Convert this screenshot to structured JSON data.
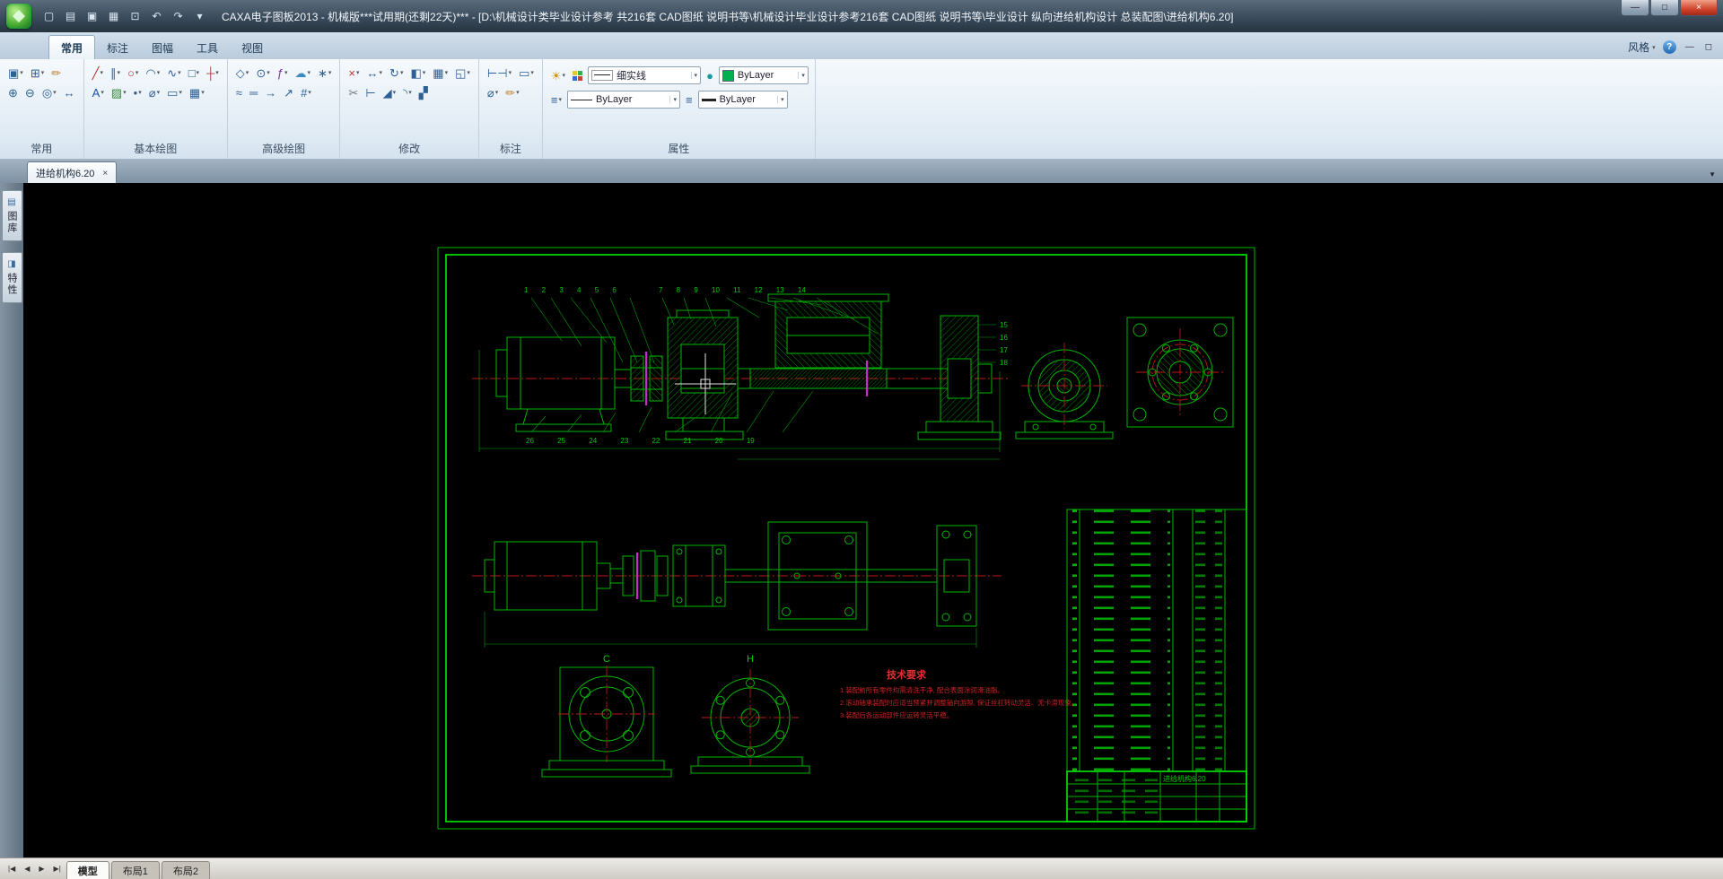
{
  "title_bar": {
    "title": "CAXA电子图板2013 - 机械版***试用期(还剩22天)*** - [D:\\机械设计类毕业设计参考 共216套 CAD图纸 说明书等\\机械设计毕业设计参考216套 CAD图纸 说明书等\\毕业设计 纵向进给机构设计 总装配图\\进给机构6.20]",
    "quick_icons": [
      {
        "n": "new",
        "g": "▢"
      },
      {
        "n": "open",
        "g": "▤"
      },
      {
        "n": "save",
        "g": "▣"
      },
      {
        "n": "print",
        "g": "▦"
      },
      {
        "n": "print-preview",
        "g": "⊡"
      },
      {
        "n": "undo",
        "g": "↶"
      },
      {
        "n": "redo",
        "g": "↷"
      },
      {
        "n": "customize-toolbar",
        "g": "▾"
      }
    ],
    "window_buttons": {
      "minimize": "—",
      "maximize": "□",
      "close": "×"
    }
  },
  "glyphs": {
    "dropdown": "▾",
    "help": "?",
    "ribbon_minimize": "—",
    "ribbon_expand": "◻",
    "doc_tab_scroll": "▼",
    "close_tab": "×"
  },
  "ribbon": {
    "style_label": "风格",
    "tabs": [
      {
        "label": "常用",
        "active": true
      },
      {
        "label": "标注",
        "active": false
      },
      {
        "label": "图幅",
        "active": false
      },
      {
        "label": "工具",
        "active": false
      },
      {
        "label": "视图",
        "active": false
      }
    ],
    "groups": [
      {
        "label": "常用",
        "rows": [
          [
            {
              "n": "paste",
              "g": "▣",
              "a": true
            },
            {
              "n": "copy",
              "g": "⊞",
              "a": true
            },
            {
              "n": "format-brush",
              "g": "✏",
              "a": false,
              "c": "#c08030"
            }
          ],
          [
            {
              "n": "zoom-in",
              "g": "⊕",
              "a": false
            },
            {
              "n": "zoom-out",
              "g": "⊖",
              "a": false
            },
            {
              "n": "zoom-all",
              "g": "◎",
              "a": true
            },
            {
              "n": "pan",
              "g": "↔",
              "a": false
            }
          ]
        ]
      },
      {
        "label": "基本绘图",
        "rows": [
          [
            {
              "n": "line",
              "g": "╱",
              "a": true,
              "c": "#b03030"
            },
            {
              "n": "parallel-line",
              "g": "∥",
              "a": true
            },
            {
              "n": "circle",
              "g": "○",
              "a": true,
              "c": "#b03030"
            },
            {
              "n": "arc",
              "g": "◠",
              "a": true
            },
            {
              "n": "spline",
              "g": "∿",
              "a": true
            },
            {
              "n": "rectangle",
              "g": "□",
              "a": true
            },
            {
              "n": "center-line",
              "g": "┼",
              "a": true,
              "c": "#a04040"
            }
          ],
          [
            {
              "n": "text",
              "g": "A",
              "a": true,
              "c": "#1f4fa0"
            },
            {
              "n": "hatch",
              "g": "▨",
              "a": true,
              "c": "#3a8a3a"
            },
            {
              "n": "point",
              "g": "•",
              "a": true
            },
            {
              "n": "hole-axis",
              "g": "⌀",
              "a": true
            },
            {
              "n": "block",
              "g": "▭",
              "a": true
            },
            {
              "n": "table",
              "g": "▦",
              "a": true
            }
          ]
        ]
      },
      {
        "label": "高级绘图",
        "rows": [
          [
            {
              "n": "polygon",
              "g": "◇",
              "a": true
            },
            {
              "n": "ellipse",
              "g": "⊙",
              "a": true
            },
            {
              "n": "formula-curve",
              "g": "ƒ",
              "a": true,
              "c": "#8030a0"
            },
            {
              "n": "revision-cloud",
              "g": "☁",
              "a": true,
              "c": "#3a8ac0"
            },
            {
              "n": "gear",
              "g": "∗",
              "a": true
            }
          ],
          [
            {
              "n": "wave-line",
              "g": "≈",
              "a": false
            },
            {
              "n": "double-line",
              "g": "═",
              "a": false
            },
            {
              "n": "arrow-line",
              "g": "→",
              "a": false
            },
            {
              "n": "leader-curve",
              "g": "↗",
              "a": false
            },
            {
              "n": "symbol",
              "g": "#",
              "a": true
            }
          ]
        ]
      },
      {
        "label": "修改",
        "rows": [
          [
            {
              "n": "erase",
              "g": "×",
              "a": true,
              "c": "#c03030"
            },
            {
              "n": "move",
              "g": "↔",
              "a": true
            },
            {
              "n": "rotate",
              "g": "↻",
              "a": true
            },
            {
              "n": "mirror",
              "g": "◧",
              "a": true
            },
            {
              "n": "array",
              "g": "▦",
              "a": true
            },
            {
              "n": "scale",
              "g": "◱",
              "a": true
            }
          ],
          [
            {
              "n": "trim",
              "g": "✂",
              "a": false,
              "c": "#707880"
            },
            {
              "n": "extend",
              "g": "⊢",
              "a": false
            },
            {
              "n": "chamfer",
              "g": "◢",
              "a": true
            },
            {
              "n": "fillet",
              "g": "◝",
              "a": true
            },
            {
              "n": "explode",
              "g": "▞",
              "a": false
            }
          ]
        ]
      },
      {
        "label": "标注",
        "rows": [
          [
            {
              "n": "dimension",
              "g": "⊢⊣",
              "a": true,
              "c": "#2060a0"
            },
            {
              "n": "dim-style",
              "g": "▭",
              "a": true
            }
          ],
          [
            {
              "n": "diameter-dim",
              "g": "⌀",
              "a": true
            },
            {
              "n": "dim-edit",
              "g": "✏",
              "a": true,
              "c": "#c08030"
            }
          ]
        ]
      }
    ],
    "properties": {
      "label": "属性",
      "linetype": "细实线",
      "color": "ByLayer",
      "linestyle": "ByLayer",
      "lineweight": "ByLayer"
    }
  },
  "doc_tabs": [
    {
      "label": "进给机构6.20",
      "active": true
    }
  ],
  "side_tabs": [
    {
      "label": "图库",
      "icon": "▤"
    },
    {
      "label": "特性",
      "icon": "◨"
    }
  ],
  "sheet_bar": {
    "nav": [
      {
        "n": "first-sheet",
        "g": "|◀"
      },
      {
        "n": "prev-sheet",
        "g": "◀"
      },
      {
        "n": "next-sheet",
        "g": "▶"
      },
      {
        "n": "last-sheet",
        "g": "▶|"
      }
    ],
    "tabs": [
      {
        "label": "模型",
        "active": true
      },
      {
        "label": "布局1",
        "active": false
      },
      {
        "label": "布局2",
        "active": false
      }
    ]
  },
  "drawing": {
    "tech_title": "技术要求",
    "tech_lines": [
      "1.装配前所有零件均需清洗干净, 配合表面涂润滑油脂。",
      "2.滚动轴承装配时应适当预紧并调整轴向游隙, 保证丝杠转动灵活、无卡滞现象。",
      "3.装配后各运动部件应运转灵活平稳。"
    ],
    "view_labels": {
      "c": "C",
      "h": "H"
    },
    "callouts": {
      "top_left": "1 2 3 4 5 6",
      "top_right": "7 8 9 10 11 12 13 14",
      "side": [
        "15",
        "16",
        "17",
        "18"
      ],
      "bottom": "26 25 24 23 22 21 20 19"
    },
    "title_block_name": "进给机构6.20"
  }
}
